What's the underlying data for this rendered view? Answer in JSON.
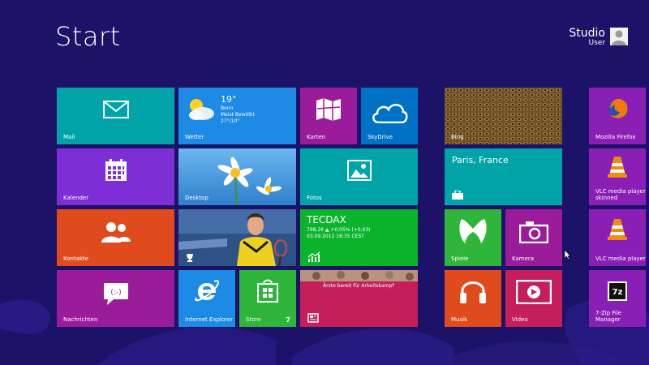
{
  "title": "Start",
  "user": {
    "name": "Studio",
    "subtitle": "User"
  },
  "tiles": {
    "mail": {
      "label": "Mail"
    },
    "weather": {
      "label": "Wetter",
      "temp": "19°",
      "city": "Bonn",
      "condition": "Meist Bewölkt",
      "range": "27°/10°"
    },
    "maps": {
      "label": "Karten"
    },
    "skydrive": {
      "label": "SkyDrive"
    },
    "bing": {
      "label": "Bing"
    },
    "firefox": {
      "label": "Mozilla Firefox"
    },
    "calendar": {
      "label": "Kalender"
    },
    "desktop": {
      "label": "Desktop"
    },
    "photos": {
      "label": "Fotos"
    },
    "travel": {
      "city": "Paris, France"
    },
    "vlc_skinned": {
      "label": "VLC media player skinned"
    },
    "contacts": {
      "label": "Kontakte"
    },
    "stock": {
      "name": "TECDAX",
      "value": "798,26 ▲ +0,05% (+0,43)",
      "date": "03.09.2012 16:35 CEST"
    },
    "games": {
      "label": "Spiele"
    },
    "camera": {
      "label": "Kamera"
    },
    "vlc": {
      "label": "VLC media player"
    },
    "messaging": {
      "label": "Nachrichten"
    },
    "ie": {
      "label": "Internet Explorer"
    },
    "store": {
      "label": "Store",
      "badge": "7"
    },
    "news": {
      "headline": "Ärzte bereit für Arbeitskampf"
    },
    "music": {
      "label": "Musik"
    },
    "video": {
      "label": "Video"
    },
    "sevenzip": {
      "label": "7-Zip File Manager"
    }
  },
  "colors": {
    "background": "#1c1268",
    "teal": "#00a3a8",
    "purple": "#7d2ed5",
    "magenta": "#9b1c9b",
    "blue": "#1d8ae6",
    "green": "#2fb53a",
    "brightGreen": "#0ab52c",
    "orange": "#e04b1e",
    "red": "#c41f5a",
    "deepBlue": "#0072c6"
  },
  "icons": [
    "mail-icon",
    "weather-icon",
    "maps-icon",
    "cloud-icon",
    "firefox-icon",
    "calendar-icon",
    "photo-icon",
    "suitcase-icon",
    "vlc-cone-icon",
    "contacts-icon",
    "chart-icon",
    "xbox-icon",
    "camera-icon",
    "chat-icon",
    "ie-icon",
    "store-bag-icon",
    "news-icon",
    "headphones-icon",
    "video-play-icon",
    "7zip-icon",
    "mouse-cursor-icon"
  ]
}
